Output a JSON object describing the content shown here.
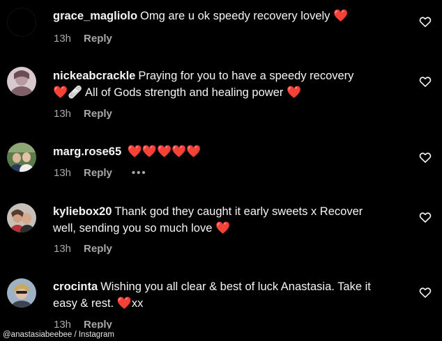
{
  "comments": [
    {
      "username": "grace_magliolo",
      "text": "Omg are u ok speedy recovery lovely",
      "emoji": "❤️",
      "time": "13h",
      "reply": "Reply"
    },
    {
      "username": "nickeabcrackle",
      "text": "Praying for you to have a speedy recovery",
      "line2_emoji": "❤️🩹",
      "line2_text": "All of Gods strength and healing power",
      "line2_emoji_end": "❤️",
      "time": "13h",
      "reply": "Reply"
    },
    {
      "username": "marg.rose65",
      "emoji": "❤️❤️❤️❤️❤️",
      "time": "13h",
      "reply": "Reply",
      "more": "•••"
    },
    {
      "username": "kyliebox20",
      "text": "Thank god they caught it early sweets x Recover",
      "line2_text": "well, sending you so much love",
      "line2_emoji_end": "❤️",
      "time": "13h",
      "reply": "Reply"
    },
    {
      "username": "crocinta",
      "text": "Wishing you all clear & best of luck Anastasia. Take it",
      "line2_text": "easy & rest.",
      "line2_emoji_mid": "❤️",
      "line2_text_end": "xx",
      "time": "13h",
      "reply": "Reply"
    }
  ],
  "caption": "@anastasiabeebee / Instagram",
  "colors": {
    "background": "#000000",
    "text": "#f5f5f5",
    "meta": "#a8a8a8",
    "heart": "#ff2a3d"
  },
  "icons": {
    "like": "heart-outline-icon"
  }
}
